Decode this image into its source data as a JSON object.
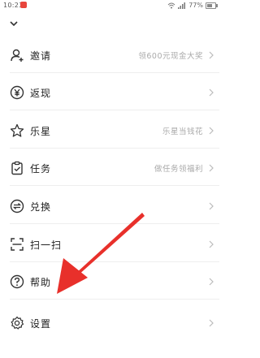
{
  "status_bar": {
    "time": "10:23",
    "battery_text": "77%"
  },
  "menu": {
    "items": [
      {
        "label": "邀请",
        "hint": "领600元现金大奖"
      },
      {
        "label": "返现",
        "hint": ""
      },
      {
        "label": "乐星",
        "hint": "乐星当钱花"
      },
      {
        "label": "任务",
        "hint": "做任务领福利"
      },
      {
        "label": "兑换",
        "hint": ""
      },
      {
        "label": "扫一扫",
        "hint": ""
      },
      {
        "label": "帮助",
        "hint": ""
      },
      {
        "label": "设置",
        "hint": ""
      }
    ]
  },
  "colors": {
    "annotation_arrow": "#e8302b",
    "hint_text": "#aaaaaa"
  }
}
